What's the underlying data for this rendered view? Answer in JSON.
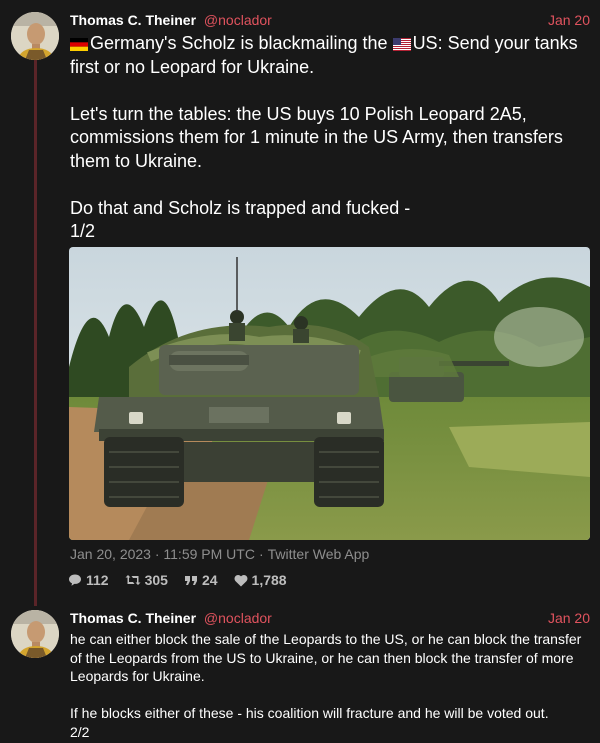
{
  "tweets": [
    {
      "author_name": "Thomas C. Theiner",
      "handle": "@noclador",
      "date": "Jan 20",
      "text_part1": "Germany's Scholz is blackmailing the ",
      "text_part2": "US: Send your tanks first or no Leopard for Ukraine.\n\nLet's turn the tables: the US buys 10 Polish Leopard 2A5, commissions them for 1 minute in the US Army, then transfers them to Ukraine.\n\nDo that and Scholz is trapped and fucked -\n1/2",
      "timestamp": "Jan 20, 2023 · 11:59 PM UTC",
      "source": "Twitter Web App",
      "stats": {
        "replies": "112",
        "retweets": "305",
        "quotes": "24",
        "likes": "1,788"
      }
    },
    {
      "author_name": "Thomas C. Theiner",
      "handle": "@noclador",
      "date": "Jan 20",
      "text": "he can either block the sale of the Leopards to the US, or he can block the transfer of the Leopards from the US to Ukraine, or he can then block the transfer of more Leopards for Ukraine.\n\nIf he blocks either of these - his coalition will fracture and he will be voted out.\n2/2"
    }
  ],
  "icons": {
    "reply": "comment-icon",
    "retweet": "retweet-icon",
    "quote": "quote-icon",
    "like": "heart-icon"
  },
  "colors": {
    "background": "#181818",
    "accent": "#e0535e",
    "thread_line": "#5a2428",
    "muted": "#8e8e8e"
  }
}
